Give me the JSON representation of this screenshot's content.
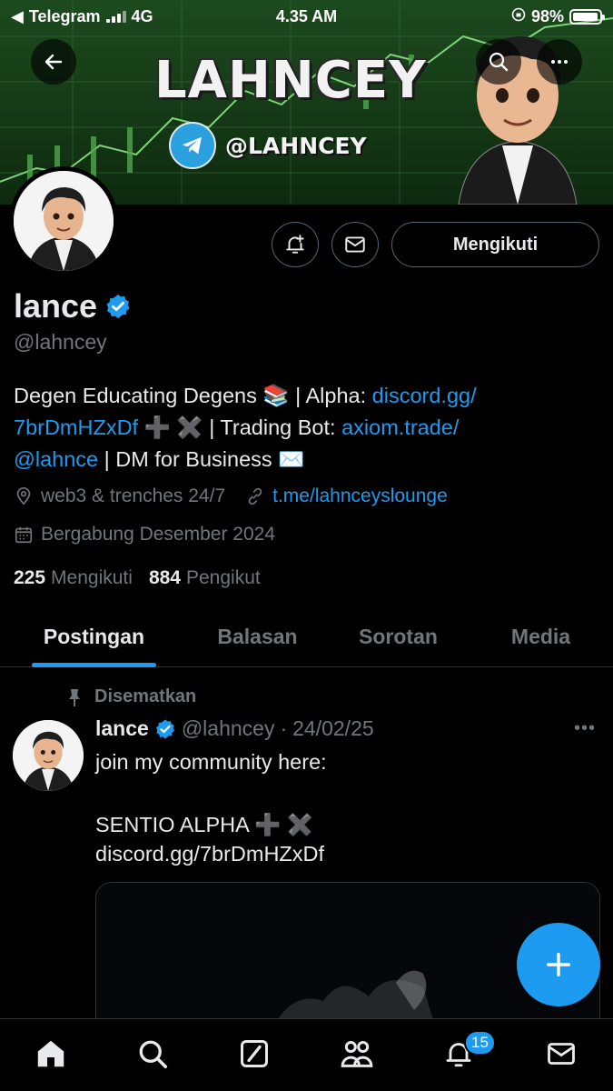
{
  "status_bar": {
    "carrier": "Telegram",
    "network": "4G",
    "time": "4.35 AM",
    "battery": "98%",
    "battery_level": 0.98
  },
  "banner": {
    "title": "LAHNCEY",
    "telegram_handle": "@LAHNCEY"
  },
  "actions": {
    "follow_label": "Mengikuti"
  },
  "profile": {
    "name": "lance",
    "handle": "@lahncey",
    "bio": {
      "part1": "Degen Educating Degens 📚 | Alpha: ",
      "link1": "discord.gg/",
      "link1b": "7brDmHZxDf",
      "part2": " ➕ ✖️ | Trading Bot: ",
      "link2": "axiom.trade/",
      "mention": "@lahnce",
      "part3": " | DM for Business ✉️"
    },
    "location": "web3 & trenches 24/7",
    "website": "t.me/lahnceyslounge",
    "joined": "Bergabung Desember 2024",
    "following_count": "225",
    "following_label": "Mengikuti",
    "followers_count": "884",
    "followers_label": "Pengikut"
  },
  "tabs": [
    {
      "label": "Postingan",
      "active": true
    },
    {
      "label": "Balasan",
      "active": false
    },
    {
      "label": "Sorotan",
      "active": false
    },
    {
      "label": "Media",
      "active": false
    }
  ],
  "post": {
    "pinned_label": "Disematkan",
    "author": "lance",
    "handle": "@lahncey",
    "dot": "·",
    "date": "24/02/25",
    "more": "•••",
    "line1": "join my community here:",
    "line2": "SENTIO ALPHA ➕ ✖️",
    "link": "discord.gg/7brDmHZxDf"
  },
  "bottom_nav": {
    "items": [
      "home-icon",
      "search-icon",
      "grok-icon",
      "communities-icon",
      "notifications-icon",
      "messages-icon"
    ],
    "notification_badge": "15"
  },
  "colors": {
    "accent": "#1d9bf0",
    "text": "#e7e9ea",
    "muted": "#71767b",
    "background": "#000000"
  }
}
